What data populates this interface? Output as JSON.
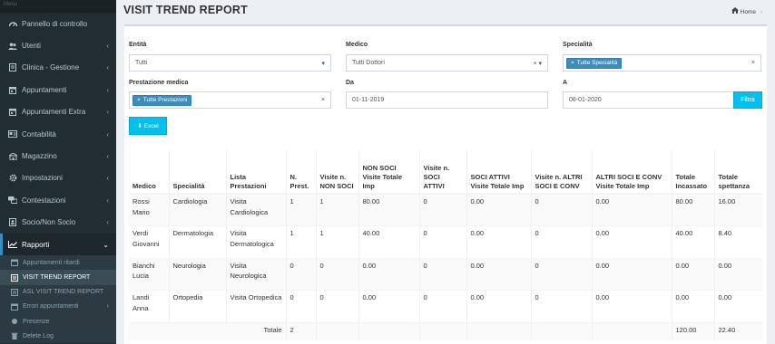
{
  "sidebar": {
    "menu_header": "Menu",
    "items": [
      {
        "label": "Pannello di controllo",
        "icon": "dashboard-icon",
        "chevron": ""
      },
      {
        "label": "Utenti",
        "icon": "users-icon",
        "chevron": "‹"
      },
      {
        "label": "Clinica - Gestione",
        "icon": "list-icon",
        "chevron": "‹"
      },
      {
        "label": "Appuntamenti",
        "icon": "calendar-icon",
        "chevron": "‹"
      },
      {
        "label": "Appuntamenti Extra",
        "icon": "calendar-icon",
        "chevron": "‹"
      },
      {
        "label": "Contabilità",
        "icon": "accounting-icon",
        "chevron": "‹"
      },
      {
        "label": "Magazzino",
        "icon": "warehouse-icon",
        "chevron": "‹"
      },
      {
        "label": "Impostazioni",
        "icon": "gear-icon",
        "chevron": "‹"
      },
      {
        "label": "Contestazioni",
        "icon": "chat-icon",
        "chevron": "‹"
      },
      {
        "label": "Socio/Non Socio",
        "icon": "member-icon",
        "chevron": "‹"
      },
      {
        "label": "Rapporti",
        "icon": "chart-icon",
        "chevron": "⌄"
      }
    ],
    "sub_items": [
      {
        "label": "Appuntamenti ritardi",
        "icon": "calendar-icon",
        "chevron": ""
      },
      {
        "label": "VISIT TREND REPORT",
        "icon": "report-icon",
        "chevron": ""
      },
      {
        "label": "ASL VISIT TREND REPORT",
        "icon": "report-icon",
        "chevron": ""
      },
      {
        "label": "Errori appuntamenti",
        "icon": "calendar-icon",
        "chevron": "‹"
      },
      {
        "label": "Presenze",
        "icon": "presence-icon",
        "chevron": ""
      },
      {
        "label": "Delete Log",
        "icon": "delete-icon",
        "chevron": ""
      }
    ]
  },
  "header": {
    "title": "VISIT TREND REPORT",
    "breadcrumb_home": "Home",
    "breadcrumb_sep": "›"
  },
  "filters": {
    "entita_label": "Entità",
    "entita_value": "Tutti",
    "entita_arrow": "▾",
    "medico_label": "Medico",
    "medico_value": "Tutti Dottori",
    "medico_controls": "× ▾",
    "specialita_label": "Specialità",
    "specialita_tag": "Tutte Specialità",
    "tag_x": "×",
    "field_clear": "×",
    "prestazione_label": "Prestazione medica",
    "prestazione_tag": "Tutte Prestazioni",
    "da_label": "Da",
    "da_value": "01-11-2019",
    "a_label": "A",
    "a_value": "08-01-2020",
    "filtra_label": "Filtra",
    "excel_label": "Excel",
    "excel_icon": "⬇"
  },
  "table": {
    "headers": [
      "Medico",
      "Specialità",
      "Lista Prestazioni",
      "N. Prest.",
      "Visite n. NON SOCI",
      "NON SOCI Visite Totale Imp",
      "Visite n. SOCI ATTIVI",
      "SOCI ATTIVI Visite Totale Imp",
      "Visite n. ALTRI SOCI E CONV",
      "ALTRI SOCI E CONV Visite Totale Imp",
      "Totale Incassato",
      "Totale spettanza"
    ],
    "rows": [
      [
        "Rossi Mario",
        "Cardiologia",
        "Visita Cardiologica",
        "1",
        "1",
        "80.00",
        "0",
        "0.00",
        "0",
        "0.00",
        "80.00",
        "16.00"
      ],
      [
        "Verdi Giovanni",
        "Dermatologia",
        "Visita Dermatologica",
        "1",
        "1",
        "40.00",
        "0",
        "0.00",
        "0",
        "0.00",
        "40.00",
        "8.40"
      ],
      [
        "Bianchi Lucia",
        "Neurologia",
        "Visita Neurologica",
        "0",
        "0",
        "0.00",
        "0",
        "0.00",
        "0",
        "0.00",
        "0.00",
        "0.00"
      ],
      [
        "Landi Anna",
        "Ortopedia",
        "Visita Ortopedica",
        "0",
        "0",
        "0.00",
        "0",
        "0.00",
        "0",
        "0.00",
        "0.00",
        "0.00"
      ]
    ],
    "footer_label": "Totale",
    "footer_prest": "2",
    "footer_incassato": "120.00",
    "footer_spettanza": "22.40"
  }
}
